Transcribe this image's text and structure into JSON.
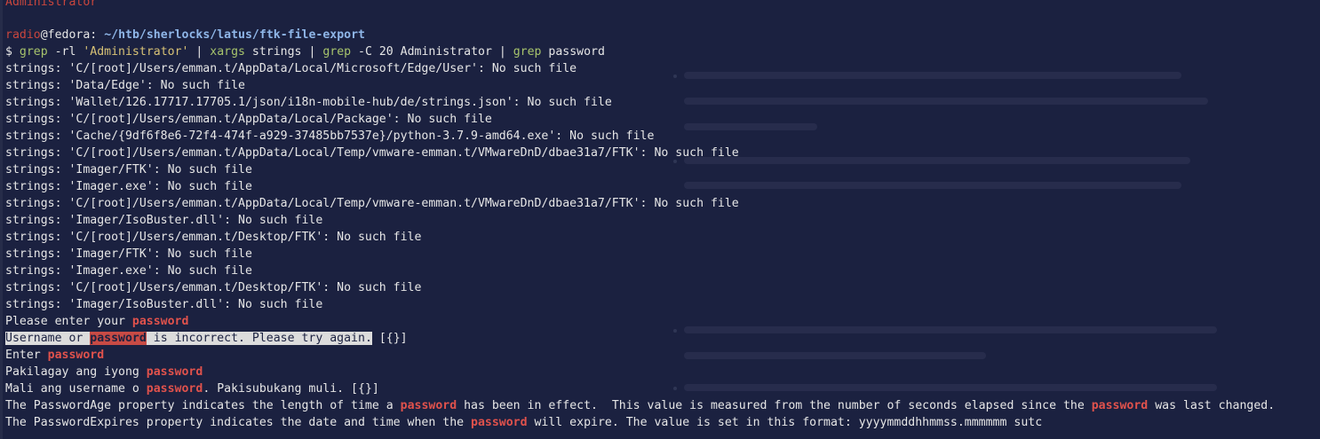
{
  "prompt": {
    "user": "radio",
    "at": "@",
    "host": "fedora",
    "separator": ":",
    "path": "~/htb/sherlocks/latus/ftk-file-export"
  },
  "previous_output_tail": "Administrator",
  "command": {
    "dollar": "$ ",
    "grep1": "grep",
    "flags1": " -rl ",
    "pattern1": "'Administrator'",
    "pipe1": " | ",
    "xargs": "xargs",
    "strings_arg": " strings | ",
    "grep2": "grep",
    "flags2": " -C 20 Administrator | ",
    "grep3": "grep",
    "pattern3": " password"
  },
  "errors": [
    "strings: 'C/[root]/Users/emman.t/AppData/Local/Microsoft/Edge/User': No such file",
    "strings: 'Data/Edge': No such file",
    "strings: 'Wallet/126.17717.17705.1/json/i18n-mobile-hub/de/strings.json': No such file",
    "strings: 'C/[root]/Users/emman.t/AppData/Local/Package': No such file",
    "strings: 'Cache/{9df6f8e6-72f4-474f-a929-37485bb7537e}/python-3.7.9-amd64.exe': No such file",
    "strings: 'C/[root]/Users/emman.t/AppData/Local/Temp/vmware-emman.t/VMwareDnD/dbae31a7/FTK': No such file",
    "strings: 'Imager/FTK': No such file",
    "strings: 'Imager.exe': No such file",
    "strings: 'C/[root]/Users/emman.t/AppData/Local/Temp/vmware-emman.t/VMwareDnD/dbae31a7/FTK': No such file",
    "strings: 'Imager/IsoBuster.dll': No such file",
    "strings: 'C/[root]/Users/emman.t/Desktop/FTK': No such file",
    "strings: 'Imager/FTK': No such file",
    "strings: 'Imager.exe': No such file",
    "strings: 'C/[root]/Users/emman.t/Desktop/FTK': No such file",
    "strings: 'Imager/IsoBuster.dll': No such file"
  ],
  "matches": {
    "keyword": "password",
    "m1_pre": "Please enter your ",
    "m2_pre": "Username or ",
    "m2_post": " is incorrect. Please try again.",
    "m2_tail": " [{}]",
    "m3_pre": "Enter ",
    "m4_pre": "Pakilagay ang iyong ",
    "m5_pre": "Mali ang username o ",
    "m5_post": ". Pakisubukang muli. [{}]",
    "m6_pre": "The PasswordAge property indicates the length of time a ",
    "m6_mid": " has been in effect.  This value is measured from the number of seconds elapsed since the ",
    "m6_post": " was last changed.",
    "m7_pre": "The PasswordExpires property indicates the date and time when the ",
    "m7_post": " will expire. The value is set in this format: yyyymmddhhmmss.mmmmmm sutc"
  }
}
